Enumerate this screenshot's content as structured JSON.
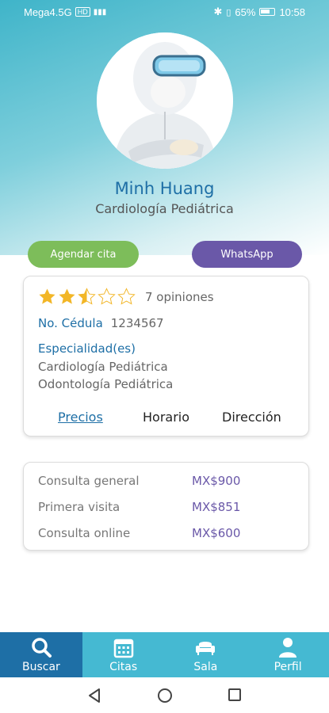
{
  "status_bar": {
    "carrier": "Mega4.5G",
    "hd_badge": "HD",
    "battery": "65%",
    "time": "10:58"
  },
  "doctor": {
    "name": "Minh Huang",
    "specialty": "Cardiología Pediátrica"
  },
  "actions": {
    "agendar_label": "Agendar cita",
    "whatsapp_label": "WhatsApp"
  },
  "rating": {
    "stars": 2.5,
    "max_stars": 5,
    "opinions_text": "7 opiniones"
  },
  "info": {
    "cedula_label": "No. Cédula",
    "cedula_value": "1234567",
    "especialidades_label": "Especialidad(es)",
    "especialidades": [
      "Cardiología Pediátrica",
      "Odontología Pediátrica"
    ]
  },
  "tabs": [
    {
      "label": "Precios",
      "active": true
    },
    {
      "label": "Horario",
      "active": false
    },
    {
      "label": "Dirección",
      "active": false
    }
  ],
  "prices": [
    {
      "label": "Consulta general",
      "value": "MX$900"
    },
    {
      "label": "Primera visita",
      "value": "MX$851"
    },
    {
      "label": "Consulta online",
      "value": "MX$600"
    }
  ],
  "bottom_nav": [
    {
      "label": "Buscar",
      "icon": "search-icon",
      "active": true
    },
    {
      "label": "Citas",
      "icon": "calendar-icon",
      "active": false
    },
    {
      "label": "Sala",
      "icon": "sofa-icon",
      "active": false
    },
    {
      "label": "Perfil",
      "icon": "user-icon",
      "active": false
    }
  ],
  "colors": {
    "primary_blue": "#1e6fa6",
    "nav_teal": "#45b9d2",
    "green": "#7dbd5a",
    "purple": "#6a58a8",
    "star": "#f2b627"
  }
}
